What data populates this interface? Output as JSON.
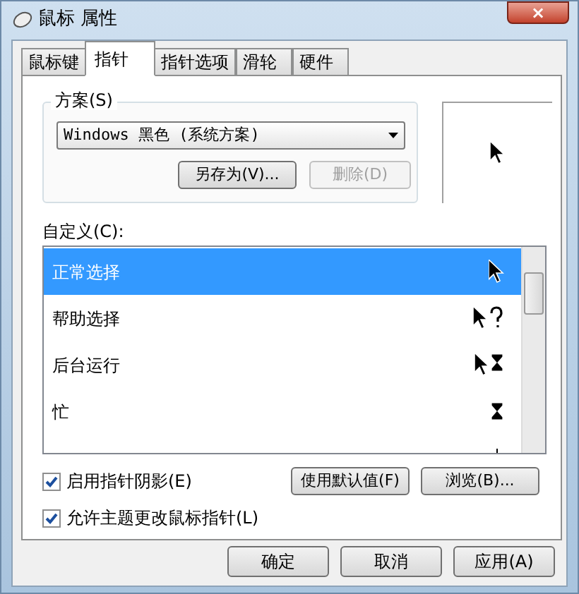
{
  "window": {
    "title": "鼠标 属性",
    "close": "×"
  },
  "tabs": [
    {
      "label": "鼠标键",
      "selected": false
    },
    {
      "label": "指针",
      "selected": true
    },
    {
      "label": "指针选项",
      "selected": false
    },
    {
      "label": "滑轮",
      "selected": false
    },
    {
      "label": "硬件",
      "selected": false
    }
  ],
  "scheme": {
    "label": "方案(S)",
    "value": "Windows 黑色 (系统方案)",
    "buttons": [
      {
        "label": "另存为(V)...",
        "disabled": false
      },
      {
        "label": "删除(D)",
        "disabled": true
      }
    ]
  },
  "customize": {
    "label": "自定义(C):",
    "rows": [
      {
        "label": "正常选择",
        "kind": "arrow",
        "selected": true
      },
      {
        "label": "帮助选择",
        "kind": "help",
        "selected": false
      },
      {
        "label": "后台运行",
        "kind": "working",
        "selected": false
      },
      {
        "label": "忙",
        "kind": "busy",
        "selected": false
      },
      {
        "kind": "precision",
        "selected": false
      }
    ]
  },
  "options": [
    {
      "label": "启用指针阴影(E)",
      "checked": true
    },
    {
      "label": "允许主题更改鼠标指针(L)",
      "checked": true
    }
  ],
  "list_buttons": [
    "使用默认值(F)",
    "浏览(B)..."
  ],
  "dialog_buttons": [
    "确定",
    "取消",
    "应用(A)"
  ]
}
